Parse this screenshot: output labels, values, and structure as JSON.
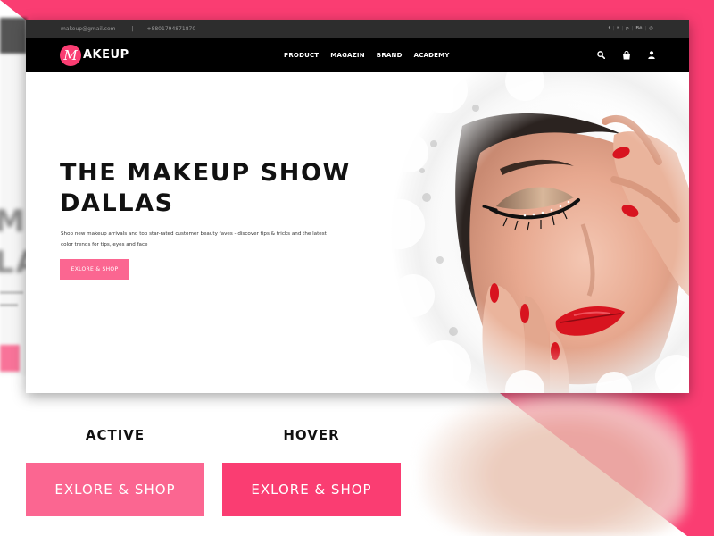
{
  "topbar": {
    "email": "makeup@gmail.com",
    "separator": "|",
    "phone": "+8801794871870",
    "social_icons": [
      "facebook-icon",
      "twitter-icon",
      "pinterest-icon",
      "behance-icon",
      "dribbble-icon"
    ],
    "social_glyphs": [
      "f",
      "t",
      "p",
      "Bē",
      "◎"
    ]
  },
  "nav": {
    "logo_letter": "M",
    "logo_text": "AKEUP",
    "menu": [
      "PRODUCT",
      "MAGAZIN",
      "BRAND",
      "ACADEMY"
    ],
    "icons": [
      "search-icon",
      "cart-icon",
      "user-icon"
    ]
  },
  "hero": {
    "title_line1": "THE MAKEUP SHOW",
    "title_line2": "DALLAS",
    "description": "Shop new makeup arrivals and top star-rated customer beauty faves - discover tips & tricks and the latest color trends for tips, eyes and face",
    "button_label": "EXLORE & SHOP"
  },
  "showcase": {
    "active_label": "ACTIVE",
    "hover_label": "HOVER",
    "active_button": "EXLORE & SHOP",
    "hover_button": "EXLORE & SHOP"
  },
  "colors": {
    "brand_pink": "#fa3d72",
    "button_pink_light": "#fb6691",
    "nav_black": "#000000",
    "topbar_dark": "#2d2d2d",
    "lip_red": "#d8141f"
  }
}
